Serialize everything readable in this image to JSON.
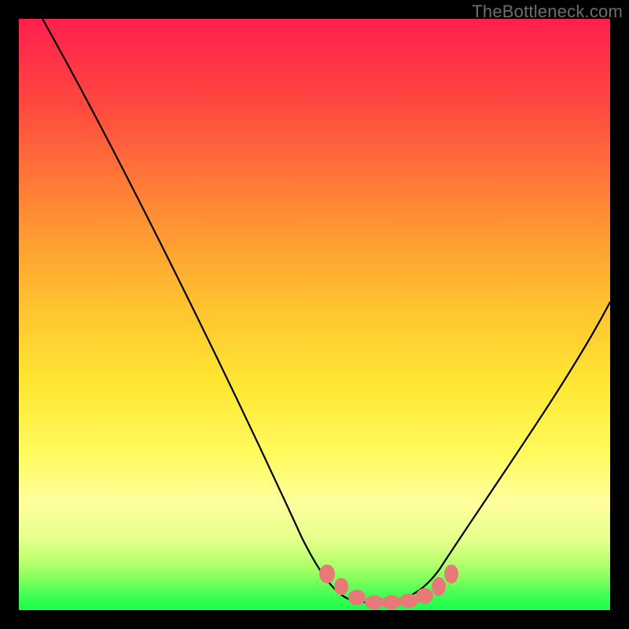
{
  "watermark": "TheBottleneck.com",
  "chart_data": {
    "type": "line",
    "title": "",
    "xlabel": "",
    "ylabel": "",
    "xlim": [
      0,
      100
    ],
    "ylim": [
      0,
      100
    ],
    "series": [
      {
        "name": "curve",
        "x": [
          4,
          10,
          20,
          30,
          40,
          50,
          53,
          57,
          60,
          63,
          67,
          70,
          74,
          80,
          90,
          100
        ],
        "y": [
          100,
          89,
          72,
          55,
          37,
          19,
          11,
          5,
          3,
          2,
          2,
          3,
          6,
          14,
          33,
          52
        ]
      }
    ],
    "markers": {
      "name": "bottom-highlight",
      "color": "#e77a78",
      "x": [
        53,
        55,
        58,
        60,
        62,
        65,
        68,
        70,
        72
      ],
      "y": [
        7,
        5,
        3,
        2,
        2,
        2,
        2,
        3,
        5
      ]
    },
    "background_gradient": {
      "top": "#ff1f4e",
      "bottom": "#1bff49"
    }
  }
}
